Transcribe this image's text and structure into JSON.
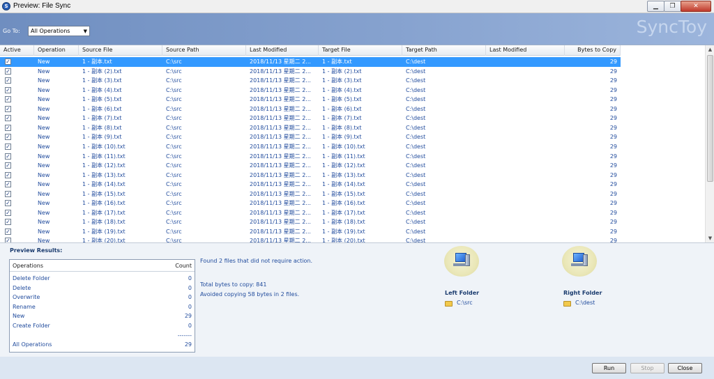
{
  "window": {
    "title": "Preview: File Sync",
    "controls": [
      "minimize",
      "restore",
      "close"
    ]
  },
  "header": {
    "goto_label": "Go To:",
    "goto_value": "All Operations",
    "brand": "SyncToy"
  },
  "grid": {
    "columns": [
      "Active",
      "Operation",
      "Source File",
      "Source Path",
      "Last Modified",
      "Target File",
      "Target Path",
      "Last Modified",
      "Bytes to Copy"
    ],
    "rows": [
      {
        "op": "New",
        "src": "1 - 副本.txt",
        "srcpath": "C:\\src",
        "mod": "2018/11/13 星期二 2...",
        "tgt": "1 - 副本.txt",
        "tgtpath": "C:\\dest",
        "bytes": "29"
      },
      {
        "op": "New",
        "src": "1 - 副本 (2).txt",
        "srcpath": "C:\\src",
        "mod": "2018/11/13 星期二 2...",
        "tgt": "1 - 副本 (2).txt",
        "tgtpath": "C:\\dest",
        "bytes": "29"
      },
      {
        "op": "New",
        "src": "1 - 副本 (3).txt",
        "srcpath": "C:\\src",
        "mod": "2018/11/13 星期二 2...",
        "tgt": "1 - 副本 (3).txt",
        "tgtpath": "C:\\dest",
        "bytes": "29"
      },
      {
        "op": "New",
        "src": "1 - 副本 (4).txt",
        "srcpath": "C:\\src",
        "mod": "2018/11/13 星期二 2...",
        "tgt": "1 - 副本 (4).txt",
        "tgtpath": "C:\\dest",
        "bytes": "29"
      },
      {
        "op": "New",
        "src": "1 - 副本 (5).txt",
        "srcpath": "C:\\src",
        "mod": "2018/11/13 星期二 2...",
        "tgt": "1 - 副本 (5).txt",
        "tgtpath": "C:\\dest",
        "bytes": "29"
      },
      {
        "op": "New",
        "src": "1 - 副本 (6).txt",
        "srcpath": "C:\\src",
        "mod": "2018/11/13 星期二 2...",
        "tgt": "1 - 副本 (6).txt",
        "tgtpath": "C:\\dest",
        "bytes": "29"
      },
      {
        "op": "New",
        "src": "1 - 副本 (7).txt",
        "srcpath": "C:\\src",
        "mod": "2018/11/13 星期二 2...",
        "tgt": "1 - 副本 (7).txt",
        "tgtpath": "C:\\dest",
        "bytes": "29"
      },
      {
        "op": "New",
        "src": "1 - 副本 (8).txt",
        "srcpath": "C:\\src",
        "mod": "2018/11/13 星期二 2...",
        "tgt": "1 - 副本 (8).txt",
        "tgtpath": "C:\\dest",
        "bytes": "29"
      },
      {
        "op": "New",
        "src": "1 - 副本 (9).txt",
        "srcpath": "C:\\src",
        "mod": "2018/11/13 星期二 2...",
        "tgt": "1 - 副本 (9).txt",
        "tgtpath": "C:\\dest",
        "bytes": "29"
      },
      {
        "op": "New",
        "src": "1 - 副本 (10).txt",
        "srcpath": "C:\\src",
        "mod": "2018/11/13 星期二 2...",
        "tgt": "1 - 副本 (10).txt",
        "tgtpath": "C:\\dest",
        "bytes": "29"
      },
      {
        "op": "New",
        "src": "1 - 副本 (11).txt",
        "srcpath": "C:\\src",
        "mod": "2018/11/13 星期二 2...",
        "tgt": "1 - 副本 (11).txt",
        "tgtpath": "C:\\dest",
        "bytes": "29"
      },
      {
        "op": "New",
        "src": "1 - 副本 (12).txt",
        "srcpath": "C:\\src",
        "mod": "2018/11/13 星期二 2...",
        "tgt": "1 - 副本 (12).txt",
        "tgtpath": "C:\\dest",
        "bytes": "29"
      },
      {
        "op": "New",
        "src": "1 - 副本 (13).txt",
        "srcpath": "C:\\src",
        "mod": "2018/11/13 星期二 2...",
        "tgt": "1 - 副本 (13).txt",
        "tgtpath": "C:\\dest",
        "bytes": "29"
      },
      {
        "op": "New",
        "src": "1 - 副本 (14).txt",
        "srcpath": "C:\\src",
        "mod": "2018/11/13 星期二 2...",
        "tgt": "1 - 副本 (14).txt",
        "tgtpath": "C:\\dest",
        "bytes": "29"
      },
      {
        "op": "New",
        "src": "1 - 副本 (15).txt",
        "srcpath": "C:\\src",
        "mod": "2018/11/13 星期二 2...",
        "tgt": "1 - 副本 (15).txt",
        "tgtpath": "C:\\dest",
        "bytes": "29"
      },
      {
        "op": "New",
        "src": "1 - 副本 (16).txt",
        "srcpath": "C:\\src",
        "mod": "2018/11/13 星期二 2...",
        "tgt": "1 - 副本 (16).txt",
        "tgtpath": "C:\\dest",
        "bytes": "29"
      },
      {
        "op": "New",
        "src": "1 - 副本 (17).txt",
        "srcpath": "C:\\src",
        "mod": "2018/11/13 星期二 2...",
        "tgt": "1 - 副本 (17).txt",
        "tgtpath": "C:\\dest",
        "bytes": "29"
      },
      {
        "op": "New",
        "src": "1 - 副本 (18).txt",
        "srcpath": "C:\\src",
        "mod": "2018/11/13 星期二 2...",
        "tgt": "1 - 副本 (18).txt",
        "tgtpath": "C:\\dest",
        "bytes": "29"
      },
      {
        "op": "New",
        "src": "1 - 副本 (19).txt",
        "srcpath": "C:\\src",
        "mod": "2018/11/13 星期二 2...",
        "tgt": "1 - 副本 (19).txt",
        "tgtpath": "C:\\dest",
        "bytes": "29"
      },
      {
        "op": "New",
        "src": "1 - 副本 (20).txt",
        "srcpath": "C:\\src",
        "mod": "2018/11/13 星期二 2...",
        "tgt": "1 - 副本 (20).txt",
        "tgtpath": "C:\\dest",
        "bytes": "29"
      }
    ]
  },
  "results": {
    "title": "Preview Results:",
    "table_headers": [
      "Operations",
      "Count"
    ],
    "operations": [
      {
        "label": "Delete Folder",
        "count": "0"
      },
      {
        "label": "Delete",
        "count": "0"
      },
      {
        "label": "Overwrite",
        "count": "0"
      },
      {
        "label": "Rename",
        "count": "0"
      },
      {
        "label": "New",
        "count": "29"
      },
      {
        "label": "Create Folder",
        "count": "0"
      }
    ],
    "separator": "-------",
    "total": {
      "label": "All Operations",
      "count": "29"
    },
    "message_found": "Found 2 files that did not require action.",
    "message_total": "Total bytes to copy: 841",
    "message_avoided": "Avoided copying 58 bytes in 2 files.",
    "left_folder": {
      "label": "Left Folder",
      "path": "C:\\src"
    },
    "right_folder": {
      "label": "Right Folder",
      "path": "C:\\dest"
    }
  },
  "footer": {
    "run": "Run",
    "stop": "Stop",
    "close": "Close"
  }
}
